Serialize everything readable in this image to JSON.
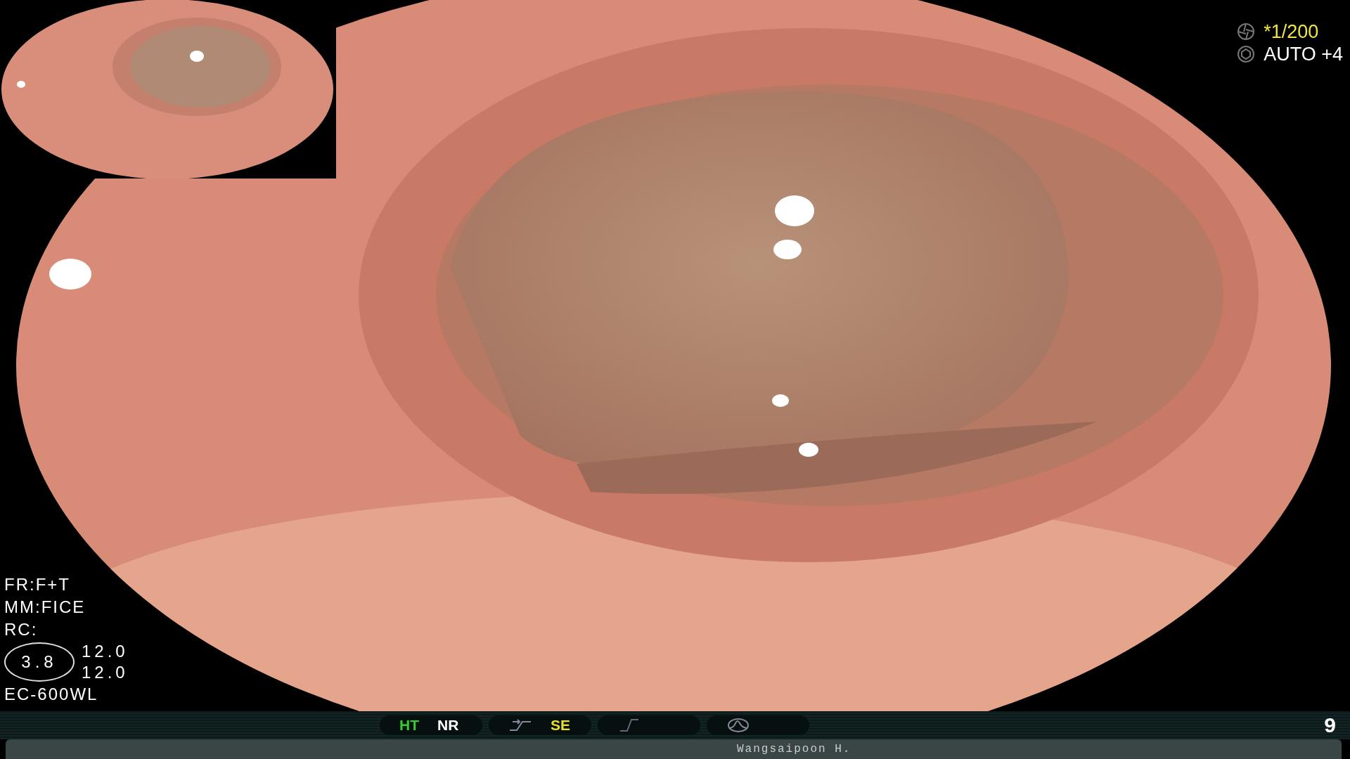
{
  "exposure": {
    "shutter": "*1/200",
    "brightness": "AUTO +4"
  },
  "info_lines": [
    "FR:F+T",
    "MM:FICE",
    "RC:"
  ],
  "zoom_value": "3.8",
  "readings": [
    "12.0",
    "12.0"
  ],
  "scope": "EC-600WL",
  "status_pills": [
    {
      "kind": "plain",
      "items": [
        {
          "label": "HT",
          "color": "#33cc33"
        },
        {
          "label": "NR",
          "color": "#ffffff"
        }
      ]
    },
    {
      "kind": "curve",
      "items": [
        {
          "label": "SE",
          "color": "#e8e030"
        }
      ]
    },
    {
      "kind": "slash"
    },
    {
      "kind": "wave"
    }
  ],
  "image_number": "9",
  "operator": "Wangsaipoon H."
}
